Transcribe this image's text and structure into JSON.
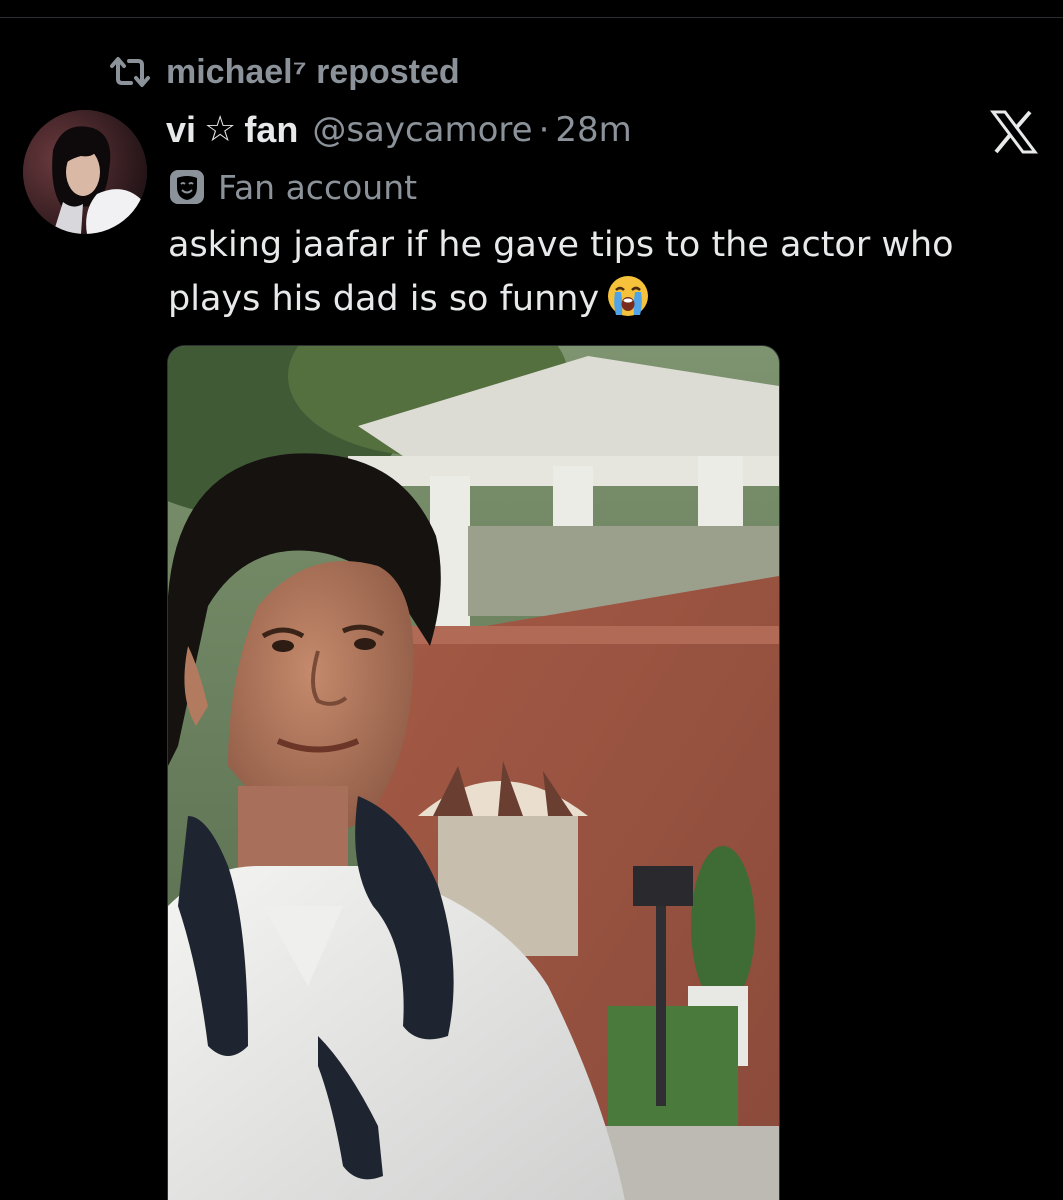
{
  "repost": {
    "icon": "repost-icon",
    "text": "michael⁷ reposted"
  },
  "tweet": {
    "author": {
      "name_part1": "vi",
      "name_star": "☆",
      "name_part2": "fan",
      "handle": "@saycamore",
      "separator": "·",
      "time": "28m",
      "label_icon": "theater-mask-icon",
      "label": "Fan account"
    },
    "text_line1": "asking jaafar if he gave tips to the actor who",
    "text_line2": "plays his dad is so funny",
    "emoji": "loudly-crying-face-emoji",
    "media_alt": "photo of a young man with curly hair wearing a white shirt and a dark towel around his neck, outdoors in front of a brick building with white columns"
  },
  "colors": {
    "background": "#000000",
    "primary_text": "#e7e9ea",
    "secondary_text": "#8b9299"
  }
}
